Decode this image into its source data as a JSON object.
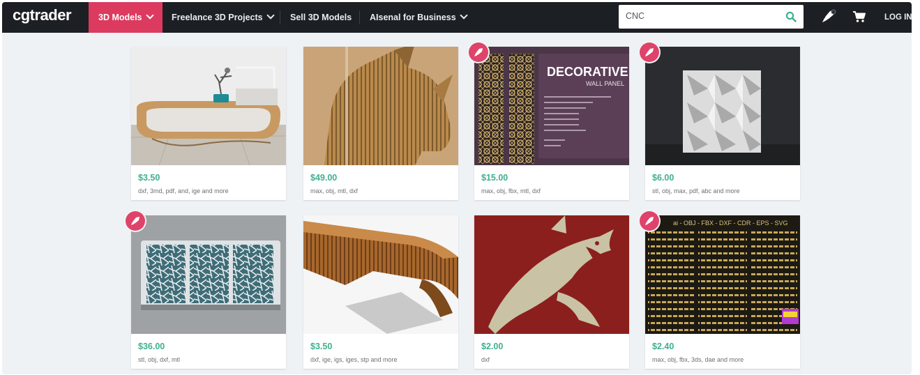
{
  "header": {
    "logo": "cgtrader",
    "nav": [
      {
        "label": "3D Models",
        "dropdown": true,
        "active": true
      },
      {
        "label": "Freelance 3D Projects",
        "dropdown": true
      },
      {
        "label": "Sell 3D Models",
        "dropdown": false
      },
      {
        "label": "AIsenal for Business",
        "dropdown": true
      }
    ],
    "search": {
      "value": "CNC",
      "icon": "search-icon"
    },
    "icons": [
      "rocket-icon",
      "cart-icon"
    ],
    "login": "LOG IN"
  },
  "colors": {
    "accent": "#dc3a5e",
    "price": "#3fb08f",
    "nav_bg": "#1c1f24",
    "badge": "#e0436a"
  },
  "products": [
    {
      "price": "$3.50",
      "formats": "dxf, 3md, pdf, and, ige and more",
      "badge": false,
      "thumb": "curved wooden console table"
    },
    {
      "price": "$49.00",
      "formats": "max, obj, mtl, dxf",
      "badge": false,
      "thumb": "plywood rhino head"
    },
    {
      "price": "$15.00",
      "formats": "max, obj, fbx, mtl, dxf",
      "badge": true,
      "thumb": "decorative wall panel",
      "thumb_text": {
        "title": "DECORATIVE",
        "subtitle": "WALL PANEL"
      }
    },
    {
      "price": "$6.00",
      "formats": "stl, obj, max, pdf, abc and more",
      "badge": true,
      "thumb": "3D wall tile"
    },
    {
      "price": "$36.00",
      "formats": "stl, obj, dxf, mtl",
      "badge": true,
      "thumb": "laser cut screen panels"
    },
    {
      "price": "$3.50",
      "formats": "dxf, ige, igs, iges, stp and more",
      "badge": false,
      "thumb": "slatted wooden bench"
    },
    {
      "price": "$2.00",
      "formats": "dxf",
      "badge": false,
      "thumb": "shark silhouette"
    },
    {
      "price": "$2.40",
      "formats": "max, obj, fbx, 3ds, dae and more",
      "badge": true,
      "thumb": "ornament borders set",
      "thumb_text": {
        "title": "ai - OBJ - FBX - DXF - CDR - EPS - SVG"
      }
    }
  ]
}
